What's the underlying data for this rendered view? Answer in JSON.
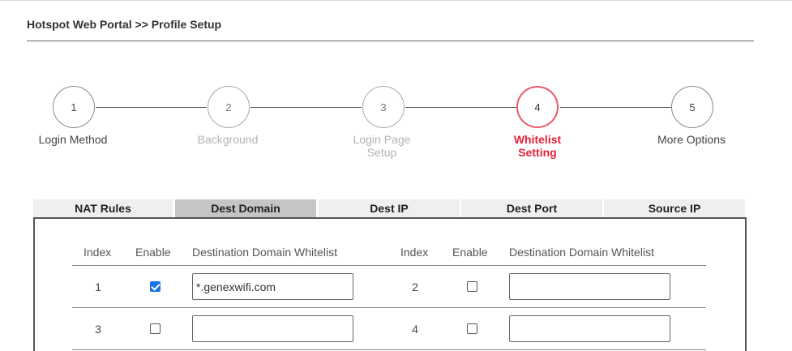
{
  "breadcrumb": "Hotspot Web Portal >> Profile Setup",
  "stepper": {
    "steps": [
      {
        "number": "1",
        "label": "Login Method",
        "state": "normal"
      },
      {
        "number": "2",
        "label": "Background",
        "state": "faded"
      },
      {
        "number": "3",
        "label": "Login Page\nSetup",
        "state": "faded"
      },
      {
        "number": "4",
        "label": "Whitelist\nSetting",
        "state": "active"
      },
      {
        "number": "5",
        "label": "More Options",
        "state": "normal"
      }
    ]
  },
  "tabs": [
    {
      "label": "NAT Rules",
      "selected": false
    },
    {
      "label": "Dest Domain",
      "selected": true
    },
    {
      "label": "Dest IP",
      "selected": false
    },
    {
      "label": "Dest Port",
      "selected": false
    },
    {
      "label": "Source IP",
      "selected": false
    }
  ],
  "table": {
    "headers": {
      "index": "Index",
      "enable": "Enable",
      "whitelist": "Destination Domain Whitelist"
    },
    "rows": [
      {
        "left": {
          "index": "1",
          "enabled": true,
          "value": "*.genexwifi.com"
        },
        "right": {
          "index": "2",
          "enabled": false,
          "value": ""
        }
      },
      {
        "left": {
          "index": "3",
          "enabled": false,
          "value": ""
        },
        "right": {
          "index": "4",
          "enabled": false,
          "value": ""
        }
      }
    ]
  },
  "colors": {
    "active_step": "#e5203a",
    "active_step_border": "#e85a6b",
    "selected_tab": "#c5c5c5",
    "tab": "#efefef",
    "checkbox_checked": "#1a73e8"
  }
}
